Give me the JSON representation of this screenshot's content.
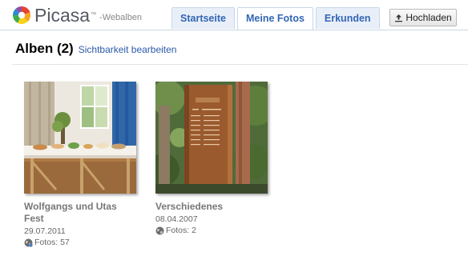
{
  "header": {
    "logo_word": "Picasa",
    "logo_tm": "™",
    "logo_sub": "-Webalben",
    "upload_label": "Hochladen"
  },
  "tabs": [
    {
      "label": "Startseite",
      "active": false
    },
    {
      "label": "Meine Fotos",
      "active": true
    },
    {
      "label": "Erkunden",
      "active": false
    }
  ],
  "albums_section": {
    "title": "Alben (2)",
    "visibility_link": "Sichtbarkeit bearbeiten"
  },
  "albums": [
    {
      "title": "Wolfgangs und Utas Fest",
      "date": "29.07.2011",
      "count": "Fotos: 57",
      "privacy_icon": "globe-people-icon"
    },
    {
      "title": "Verschiedenes",
      "date": "08.04.2007",
      "count": "Fotos: 2",
      "privacy_icon": "globe-icon"
    }
  ],
  "colors": {
    "link": "#2a59a8",
    "tab_text": "#3266b5",
    "tab_bg": "#e9eff8"
  }
}
